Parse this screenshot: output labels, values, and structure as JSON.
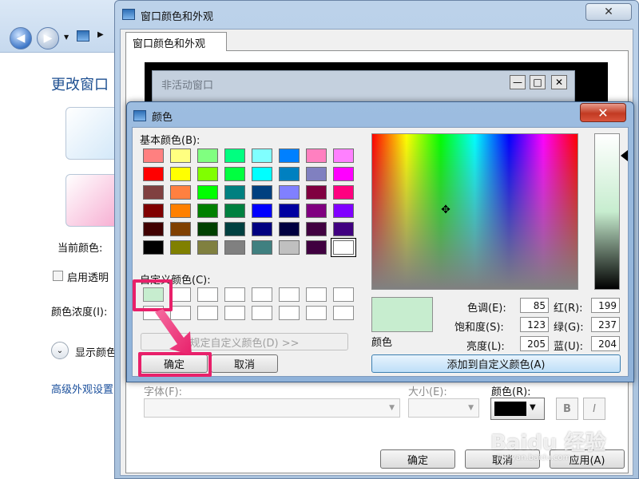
{
  "explorer": {
    "title": "更改窗口",
    "current_color_label": "当前颜色:",
    "transparency_label": "启用透明",
    "intensity_label": "颜色浓度(I):",
    "expand_label": "显示颜色",
    "advanced_link": "高级外观设置"
  },
  "appearance_dialog": {
    "title": "窗口颜色和外观",
    "tab_label": "窗口颜色和外观",
    "preview_inactive_title": "非活动窗口",
    "font_label": "字体(F):",
    "size_label": "大小(E):",
    "color_label": "颜色(R):",
    "bold_label": "B",
    "italic_label": "I",
    "ok_label": "确定",
    "cancel_label": "取消",
    "apply_label": "应用(A)"
  },
  "color_dialog": {
    "title": "颜色",
    "basic_colors_label": "基本颜色(B):",
    "custom_colors_label": "自定义颜色(C):",
    "define_custom_label": "规定自定义颜色(D) >>",
    "ok_label": "确定",
    "cancel_label": "取消",
    "add_custom_label": "添加到自定义颜色(A)",
    "preview_label": "颜色",
    "basic_colors": [
      [
        "#ff8080",
        "#ffff80",
        "#80ff80",
        "#00ff80",
        "#80ffff",
        "#0080ff",
        "#ff80c0",
        "#ff80ff"
      ],
      [
        "#ff0000",
        "#ffff00",
        "#80ff00",
        "#00ff40",
        "#00ffff",
        "#0080c0",
        "#8080c0",
        "#ff00ff"
      ],
      [
        "#804040",
        "#ff8040",
        "#00ff00",
        "#008080",
        "#004080",
        "#8080ff",
        "#800040",
        "#ff0080"
      ],
      [
        "#800000",
        "#ff8000",
        "#008000",
        "#008040",
        "#0000ff",
        "#0000a0",
        "#800080",
        "#8000ff"
      ],
      [
        "#400000",
        "#804000",
        "#004000",
        "#004040",
        "#000080",
        "#000040",
        "#400040",
        "#400080"
      ],
      [
        "#000000",
        "#808000",
        "#808040",
        "#808080",
        "#408080",
        "#c0c0c0",
        "#400040",
        "#ffffff"
      ]
    ],
    "selected_basic": [
      5,
      7
    ],
    "custom_colors": [
      "#c7edcf",
      "#ffffff",
      "#ffffff",
      "#ffffff",
      "#ffffff",
      "#ffffff",
      "#ffffff",
      "#ffffff",
      "#ffffff",
      "#ffffff",
      "#ffffff",
      "#ffffff",
      "#ffffff",
      "#ffffff",
      "#ffffff",
      "#ffffff"
    ],
    "fields": {
      "hue": {
        "label": "色调(E):",
        "value": "85"
      },
      "sat": {
        "label": "饱和度(S):",
        "value": "123"
      },
      "lum": {
        "label": "亮度(L):",
        "value": "205"
      },
      "red": {
        "label": "红(R):",
        "value": "199"
      },
      "green": {
        "label": "绿(G):",
        "value": "237"
      },
      "blue": {
        "label": "蓝(U):",
        "value": "204"
      }
    },
    "current_color": "#c7edcf"
  },
  "colors": {
    "highlight": "#e8206a",
    "selected_color": "#c7edcf"
  },
  "watermark": {
    "text": "Baidu 经验",
    "url": "jingyan.baidu.com"
  }
}
